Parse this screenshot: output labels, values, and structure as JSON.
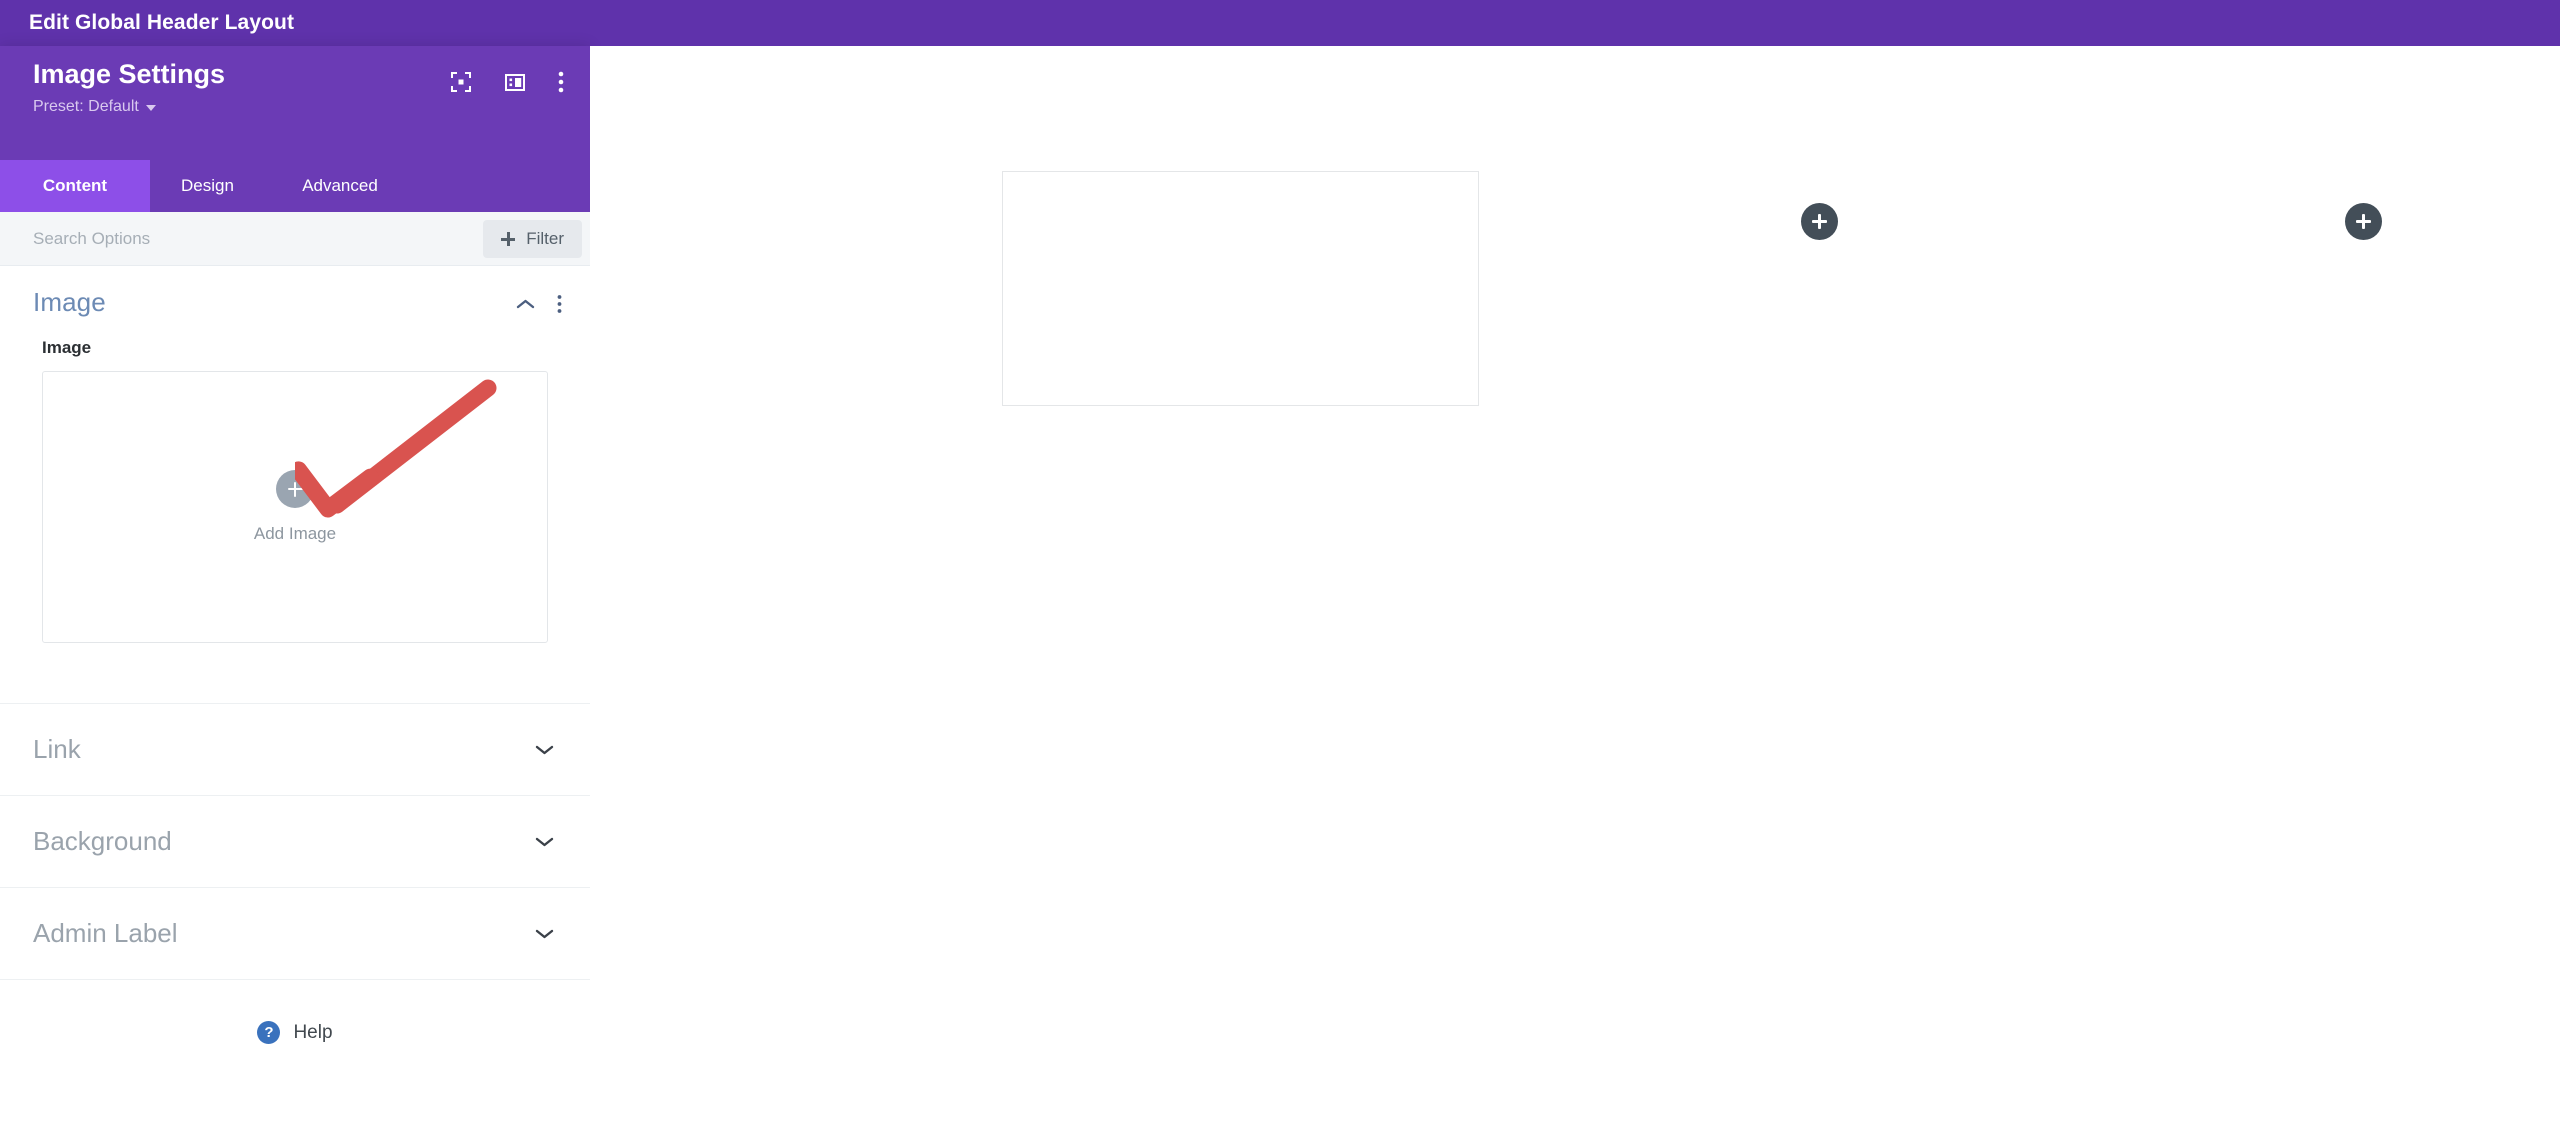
{
  "topbar": {
    "title": "Edit Global Header Layout",
    "bg_color": "#5f32ab"
  },
  "panel": {
    "title": "Image Settings",
    "preset_label": "Preset: Default",
    "bg_color": "#6b3bb5",
    "header_icons": [
      {
        "name": "focus-target-icon",
        "label": "Focus"
      },
      {
        "name": "layout-panel-icon",
        "label": "Panel Layout"
      },
      {
        "name": "more-vertical-icon",
        "label": "More Options"
      }
    ],
    "tabs": [
      {
        "label": "Content",
        "active": true
      },
      {
        "label": "Design",
        "active": false
      },
      {
        "label": "Advanced",
        "active": false
      }
    ],
    "search": {
      "placeholder": "Search Options",
      "value": ""
    },
    "filter_button": {
      "label": "Filter"
    },
    "groups": [
      {
        "title": "Image",
        "expanded": true,
        "accent_color": "#6c8ab4",
        "field": {
          "label": "Image",
          "dropzone_label": "Add Image"
        }
      },
      {
        "title": "Link",
        "expanded": false
      },
      {
        "title": "Background",
        "expanded": false
      },
      {
        "title": "Admin Label",
        "expanded": false
      }
    ],
    "help": {
      "label": "Help",
      "icon_glyph": "?",
      "icon_color": "#3a72bd"
    }
  },
  "canvas": {
    "bg_color": "#ffffff",
    "module_box": {
      "label": ""
    },
    "add_buttons": [
      {
        "name": "add-section-button-1"
      },
      {
        "name": "add-section-button-2"
      }
    ],
    "add_button_color": "#434e58"
  },
  "annotation": {
    "type": "arrow",
    "color": "#d9534f",
    "points_to": "Add Image"
  }
}
